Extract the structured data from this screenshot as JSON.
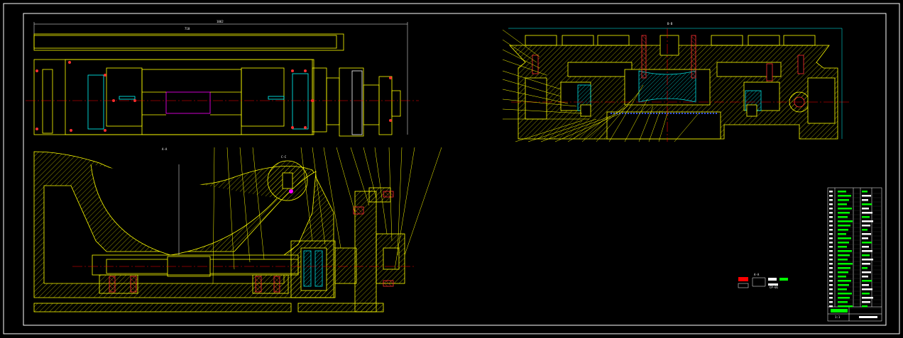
{
  "drawing": {
    "background": "#000000",
    "colors": {
      "frame": "#ffffff",
      "outline": "#ffff00",
      "hatch": "#c8c800",
      "centerline": "#ff0000",
      "dimension": "#00ffff",
      "accent": "#ff00ff",
      "green": "#00ff00",
      "blue": "#3050ff"
    },
    "views": {
      "top_view": {
        "dim_overall": "1062",
        "dim_inner": "710"
      },
      "section_a": {
        "title": "A-A",
        "detail": "C-C"
      },
      "section_b": {
        "title": "B-B"
      },
      "detail_small": {
        "label": "A-A"
      }
    },
    "title_block": {
      "scale": "1:1",
      "drawing_no": "CP-01"
    }
  }
}
